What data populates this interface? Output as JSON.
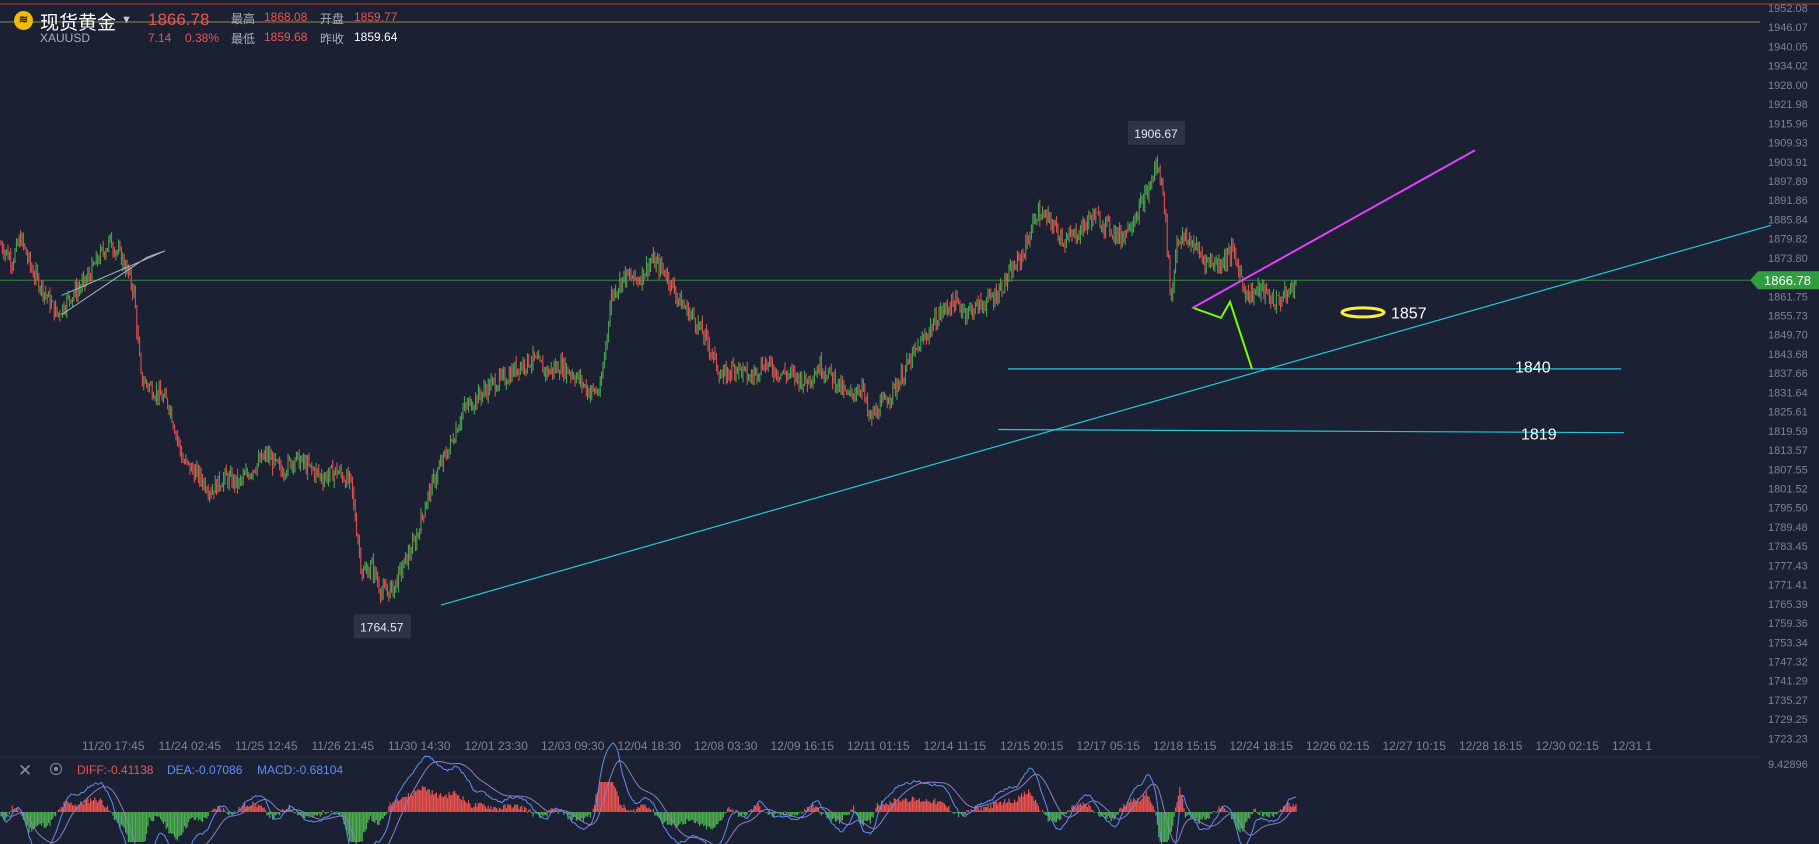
{
  "header": {
    "name": "现货黄金",
    "symbol": "XAUUSD",
    "price": "1866.78",
    "change": "7.14",
    "change_pct": "0.38%",
    "high_label": "最高",
    "high": "1868.08",
    "open_label": "开盘",
    "open": "1859.77",
    "low_label": "最低",
    "low": "1859.68",
    "prev_label": "昨收",
    "prev": "1859.64"
  },
  "chart_data": {
    "type": "candlestick",
    "y_ticks": [
      "1952.08",
      "1946.07",
      "1940.05",
      "1934.02",
      "1928.00",
      "1921.98",
      "1915.96",
      "1909.93",
      "1903.91",
      "1897.89",
      "1891.86",
      "1885.84",
      "1879.82",
      "1873.80",
      "1867.77",
      "1861.75",
      "1855.73",
      "1849.70",
      "1843.68",
      "1837.66",
      "1831.64",
      "1825.61",
      "1819.59",
      "1813.57",
      "1807.55",
      "1801.52",
      "1795.50",
      "1789.48",
      "1783.45",
      "1777.43",
      "1771.41",
      "1765.39",
      "1759.36",
      "1753.34",
      "1747.32",
      "1741.29",
      "1735.27",
      "1729.25",
      "1723.23"
    ],
    "x_ticks": [
      "11/20 17:45",
      "11/24 02:45",
      "11/25 12:45",
      "11/26 21:45",
      "11/30 14:30",
      "12/01 23:30",
      "12/03 09:30",
      "12/04 18:30",
      "12/08 03:30",
      "12/09 16:15",
      "12/11 01:15",
      "12/14 11:15",
      "12/15 20:15",
      "12/17 05:15",
      "12/18 15:15",
      "12/24 18:15",
      "12/26 02:15",
      "12/27 10:15",
      "12/28 18:15",
      "12/30 02:15",
      "12/31 1"
    ],
    "current_price": "1866.78",
    "high_marker": "1906.67",
    "low_marker": "1764.57",
    "annotations": [
      "1857",
      "1840",
      "1819"
    ],
    "price_path": [
      [
        0,
        1878
      ],
      [
        8,
        1873
      ],
      [
        14,
        1880
      ],
      [
        22,
        1870
      ],
      [
        30,
        1864
      ],
      [
        40,
        1856
      ],
      [
        50,
        1862
      ],
      [
        60,
        1866
      ],
      [
        70,
        1874
      ],
      [
        78,
        1879
      ],
      [
        86,
        1874
      ],
      [
        90,
        1870
      ],
      [
        95,
        1863
      ],
      [
        100,
        1836
      ],
      [
        110,
        1832
      ],
      [
        120,
        1828
      ],
      [
        130,
        1810
      ],
      [
        140,
        1806
      ],
      [
        150,
        1801
      ],
      [
        160,
        1805
      ],
      [
        170,
        1803
      ],
      [
        180,
        1808
      ],
      [
        190,
        1812
      ],
      [
        200,
        1807
      ],
      [
        210,
        1811
      ],
      [
        220,
        1808
      ],
      [
        230,
        1805
      ],
      [
        240,
        1807
      ],
      [
        250,
        1803
      ],
      [
        258,
        1775
      ],
      [
        265,
        1777
      ],
      [
        272,
        1769
      ],
      [
        280,
        1770
      ],
      [
        288,
        1778
      ],
      [
        296,
        1785
      ],
      [
        304,
        1798
      ],
      [
        312,
        1807
      ],
      [
        320,
        1814
      ],
      [
        330,
        1826
      ],
      [
        340,
        1830
      ],
      [
        350,
        1834
      ],
      [
        360,
        1836
      ],
      [
        370,
        1840
      ],
      [
        380,
        1842
      ],
      [
        390,
        1838
      ],
      [
        400,
        1840
      ],
      [
        410,
        1837
      ],
      [
        420,
        1832
      ],
      [
        428,
        1832
      ],
      [
        436,
        1862
      ],
      [
        445,
        1868
      ],
      [
        455,
        1867
      ],
      [
        465,
        1873
      ],
      [
        475,
        1869
      ],
      [
        485,
        1860
      ],
      [
        495,
        1855
      ],
      [
        505,
        1847
      ],
      [
        515,
        1836
      ],
      [
        525,
        1840
      ],
      [
        535,
        1836
      ],
      [
        545,
        1841
      ],
      [
        555,
        1838
      ],
      [
        565,
        1837
      ],
      [
        575,
        1835
      ],
      [
        585,
        1840
      ],
      [
        595,
        1836
      ],
      [
        605,
        1830
      ],
      [
        615,
        1834
      ],
      [
        620,
        1823
      ],
      [
        630,
        1828
      ],
      [
        640,
        1834
      ],
      [
        650,
        1842
      ],
      [
        660,
        1849
      ],
      [
        670,
        1856
      ],
      [
        680,
        1860
      ],
      [
        690,
        1857
      ],
      [
        700,
        1859
      ],
      [
        710,
        1862
      ],
      [
        720,
        1868
      ],
      [
        730,
        1875
      ],
      [
        740,
        1888
      ],
      [
        750,
        1885
      ],
      [
        760,
        1879
      ],
      [
        770,
        1882
      ],
      [
        780,
        1887
      ],
      [
        790,
        1884
      ],
      [
        800,
        1880
      ],
      [
        810,
        1887
      ],
      [
        820,
        1895
      ],
      [
        825,
        1903
      ],
      [
        830,
        1896
      ],
      [
        836,
        1860
      ],
      [
        840,
        1880
      ],
      [
        850,
        1879
      ],
      [
        860,
        1873
      ],
      [
        870,
        1872
      ],
      [
        880,
        1876
      ],
      [
        890,
        1862
      ],
      [
        900,
        1864
      ],
      [
        910,
        1860
      ],
      [
        918,
        1862
      ],
      [
        925,
        1866
      ]
    ],
    "trend_lines": [
      {
        "color": "#26c6da",
        "from": [
          315,
          1765
        ],
        "to": [
          1265,
          1884
        ]
      },
      {
        "color": "#26c6da",
        "from": [
          720,
          1839
        ],
        "to": [
          1158,
          1839
        ]
      },
      {
        "color": "#26c6da",
        "from": [
          713,
          1820
        ],
        "to": [
          1160,
          1819
        ]
      }
    ],
    "macd": {
      "DIFF": "-0.41138",
      "DEA": "-0.07086",
      "MACD": "-0.68104",
      "scale": "9.42896",
      "colors": {
        "diff": "#ef5350",
        "dea": "#5b8ff9",
        "macd": "#ef5350"
      }
    }
  },
  "colors": {
    "background": "#1b2132",
    "up": "#4caf50",
    "down": "#ef5350",
    "price_badge": "#2e9e3e",
    "cyan": "#26c6da",
    "magenta": "#e040fb",
    "green_proj": "#76ff03",
    "yellow": "#ffeb3b"
  }
}
